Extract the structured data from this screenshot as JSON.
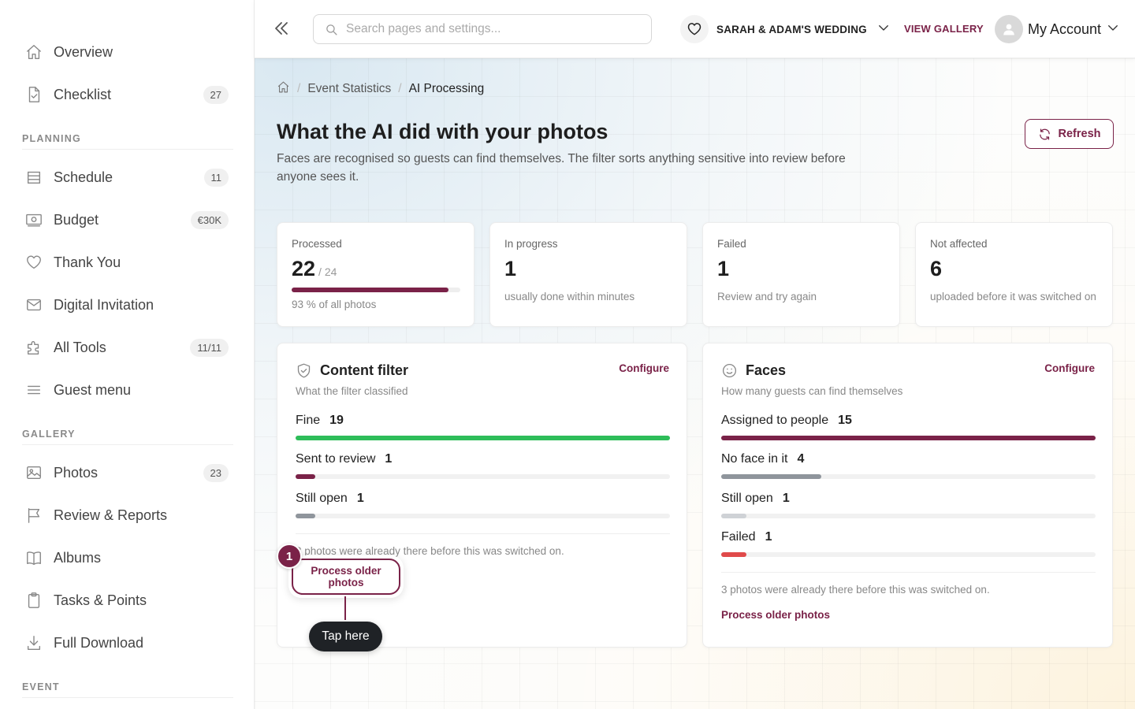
{
  "sidebar": {
    "items": [
      {
        "label": "Overview",
        "icon": "home-icon"
      },
      {
        "label": "Checklist",
        "icon": "checklist-icon",
        "badge": "27"
      },
      {
        "label": "Schedule",
        "icon": "schedule-icon",
        "badge": "11"
      },
      {
        "label": "Budget",
        "icon": "budget-icon",
        "badge": "€30K"
      },
      {
        "label": "Thank You",
        "icon": "heart-icon"
      },
      {
        "label": "Digital Invitation",
        "icon": "mail-icon"
      },
      {
        "label": "All Tools",
        "icon": "puzzle-icon",
        "badge": "11/11"
      },
      {
        "label": "Guest menu",
        "icon": "menu-icon"
      },
      {
        "label": "Photos",
        "icon": "image-icon",
        "badge": "23"
      },
      {
        "label": "Review & Reports",
        "icon": "flag-icon"
      },
      {
        "label": "Albums",
        "icon": "book-icon"
      },
      {
        "label": "Tasks & Points",
        "icon": "clipboard-icon"
      },
      {
        "label": "Full Download",
        "icon": "download-icon"
      }
    ],
    "sections": {
      "planning": "PLANNING",
      "gallery": "GALLERY",
      "event": "EVENT"
    }
  },
  "header": {
    "search_placeholder": "Search pages and settings...",
    "event_name": "SARAH & ADAM'S WEDDING",
    "view_gallery": "VIEW GALLERY",
    "account": "My Account"
  },
  "breadcrumb": {
    "parent": "Event Statistics",
    "current": "AI Processing"
  },
  "page": {
    "title": "What the AI did with your photos",
    "description": "Faces are recognised so guests can find themselves. The filter sorts anything sensitive into review before anyone sees it.",
    "refresh": "Refresh"
  },
  "stats": [
    {
      "label": "Processed",
      "value": "22",
      "of": "/ 24",
      "progress": 0.93,
      "desc": "93 % of all photos"
    },
    {
      "label": "In progress",
      "value": "1",
      "desc": "usually done within minutes"
    },
    {
      "label": "Failed",
      "value": "1",
      "desc": "Review and try again"
    },
    {
      "label": "Not affected",
      "value": "6",
      "desc": "uploaded before it was switched on"
    }
  ],
  "content_filter": {
    "title": "Content filter",
    "subtitle": "What the filter classified",
    "configure": "Configure",
    "metrics": [
      {
        "label": "Fine",
        "value": "19",
        "fraction": 1.0,
        "color": "#2ebd59"
      },
      {
        "label": "Sent to review",
        "value": "1",
        "fraction": 0.053,
        "color": "#7a2248"
      },
      {
        "label": "Still open",
        "value": "1",
        "fraction": 0.053,
        "color": "#8f959c"
      }
    ],
    "note": "3 photos were already there before this was switched on.",
    "process_link": "Process older photos"
  },
  "faces": {
    "title": "Faces",
    "subtitle": "How many guests can find themselves",
    "configure": "Configure",
    "metrics": [
      {
        "label": "Assigned to people",
        "value": "15",
        "fraction": 1.0,
        "color": "#7a2248"
      },
      {
        "label": "No face in it",
        "value": "4",
        "fraction": 0.267,
        "color": "#8f959c"
      },
      {
        "label": "Still open",
        "value": "1",
        "fraction": 0.067,
        "color": "#cfd2d6"
      },
      {
        "label": "Failed",
        "value": "1",
        "fraction": 0.067,
        "color": "#e04a4a"
      }
    ],
    "note": "3 photos were already there before this was switched on.",
    "process_link": "Process older photos"
  },
  "tutorial": {
    "step": "1",
    "button": "Process older photos",
    "tip": "Tap here"
  },
  "colors": {
    "accent": "#7a2248",
    "success": "#2ebd59",
    "danger": "#e04a4a"
  }
}
